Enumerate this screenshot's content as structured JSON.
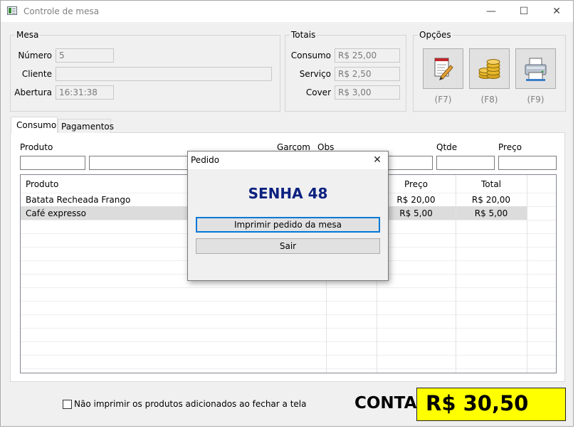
{
  "window": {
    "title": "Controle de mesa",
    "minimize_glyph": "—",
    "maximize_glyph": "☐",
    "close_glyph": "✕"
  },
  "mesa": {
    "title": "Mesa",
    "numero_label": "Número",
    "numero_value": "5",
    "cliente_label": "Cliente",
    "cliente_value": "",
    "abertura_label": "Abertura",
    "abertura_value": "16:31:38"
  },
  "totais": {
    "title": "Totais",
    "consumo_label": "Consumo",
    "consumo_value": "R$ 25,00",
    "servico_label": "Serviço",
    "servico_value": "R$ 2,50",
    "cover_label": "Cover",
    "cover_value": "R$ 3,00"
  },
  "opcoes": {
    "title": "Opções",
    "buttons": [
      {
        "icon": "notepad-pencil-icon",
        "key": "(F7)"
      },
      {
        "icon": "coins-icon",
        "key": "(F8)"
      },
      {
        "icon": "printer-icon",
        "key": "(F9)"
      }
    ]
  },
  "tabs": [
    {
      "label": "Consumo",
      "active": true
    },
    {
      "label": "Pagamentos",
      "active": false
    }
  ],
  "entry_headers": {
    "produto": "Produto",
    "garcom": "Garçom",
    "obs": "Obs",
    "qtde": "Qtde",
    "preco": "Preço"
  },
  "table": {
    "columns": {
      "produto": "Produto",
      "preco": "Preço",
      "total": "Total"
    },
    "rows": [
      {
        "produto": "Batata Recheada Frango",
        "preco": "R$ 20,00",
        "total": "R$ 20,00",
        "selected": false
      },
      {
        "produto": "Café expresso",
        "preco": "R$ 5,00",
        "total": "R$ 5,00",
        "selected": true
      }
    ]
  },
  "dialog": {
    "title": "Pedido",
    "close_glyph": "✕",
    "senha": "SENHA 48",
    "senha_color": "#0c2180",
    "print_button": "Imprimir pedido da mesa",
    "exit_button": "Sair"
  },
  "footer": {
    "checkbox_label": "Não imprimir os produtos adicionados ao fechar a tela",
    "checkbox_checked": false,
    "conta_label": "CONTA",
    "conta_value": "R$ 30,50",
    "conta_bg": "#ffff00"
  }
}
